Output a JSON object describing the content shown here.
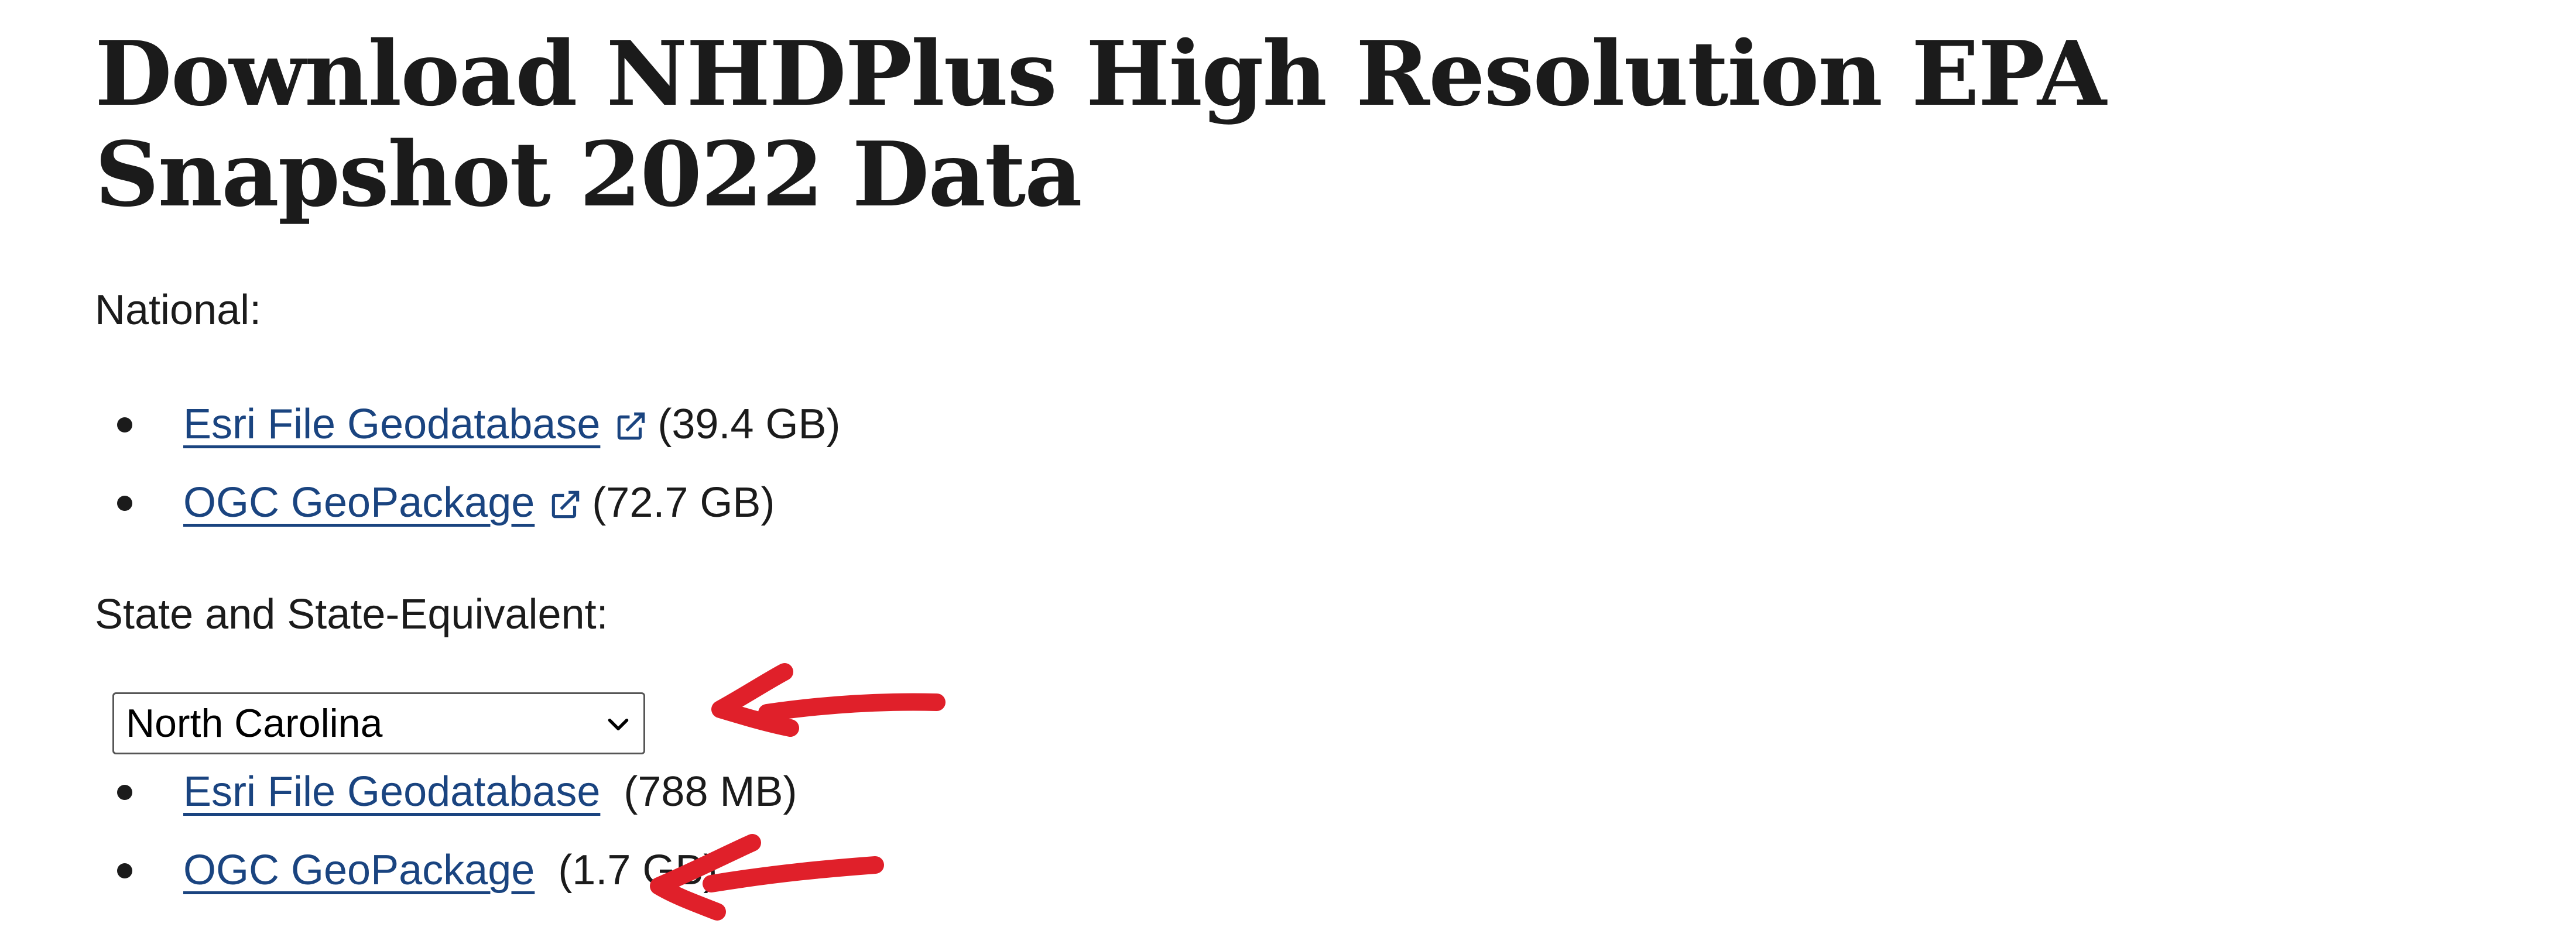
{
  "page": {
    "title": "Download NHDPlus High Resolution EPA Snapshot 2022 Data"
  },
  "national": {
    "label": "National:",
    "items": [
      {
        "label": "Esri File Geodatabase",
        "size": "(39.4 GB)",
        "external": true
      },
      {
        "label": "OGC GeoPackage",
        "size": "(72.7 GB)",
        "external": true
      }
    ]
  },
  "state": {
    "label": "State and State-Equivalent:",
    "selected": "North Carolina",
    "items": [
      {
        "label": "Esri File Geodatabase",
        "size": "(788 MB)"
      },
      {
        "label": "OGC GeoPackage",
        "size": "(1.7 GB)"
      }
    ]
  },
  "colors": {
    "link": "#1a4480",
    "text": "#1b1b1b",
    "annotation": "#e0202a"
  },
  "icons": {
    "external": "external-link-icon",
    "dropdown": "chevron-down-icon",
    "annotation": "red-arrow-annotation"
  }
}
